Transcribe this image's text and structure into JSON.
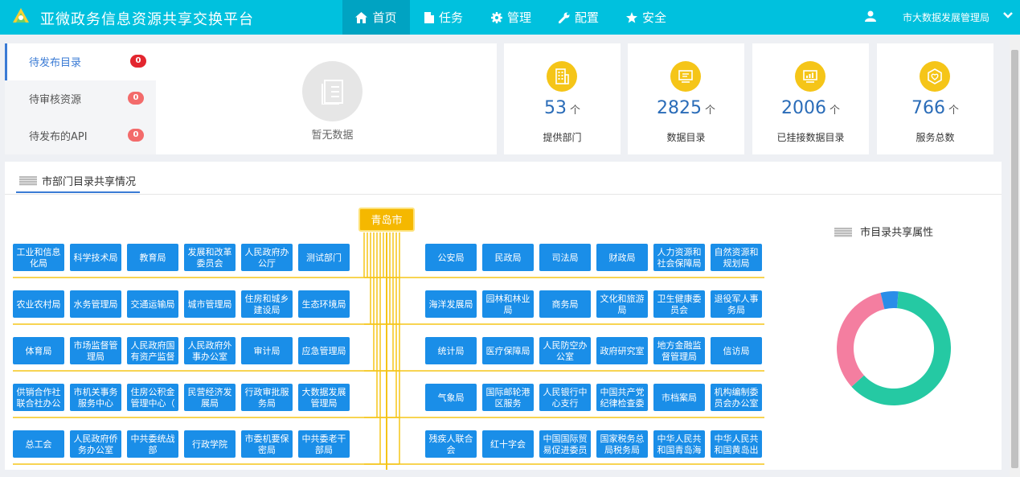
{
  "header": {
    "title": "亚微政务信息资源共享交换平台",
    "nav": [
      {
        "label": "首页",
        "icon": "home-icon",
        "active": true
      },
      {
        "label": "任务",
        "icon": "document-icon",
        "active": false
      },
      {
        "label": "管理",
        "icon": "gear-icon",
        "active": false
      },
      {
        "label": "配置",
        "icon": "wrench-icon",
        "active": false
      },
      {
        "label": "安全",
        "icon": "star-icon",
        "active": false
      }
    ],
    "user": "市大数据发展管理局"
  },
  "pending_tabs": [
    {
      "label": "待发布目录",
      "count": "0",
      "active": true,
      "badge_color": "#e3262f"
    },
    {
      "label": "待审核资源",
      "count": "0",
      "active": false,
      "badge_color": "#f36b6b"
    },
    {
      "label": "待发布的API",
      "count": "0",
      "active": false,
      "badge_color": "#f36b6b"
    }
  ],
  "empty_text": "暂无数据",
  "stats": [
    {
      "value": "53",
      "unit": "个",
      "label": "提供部门",
      "icon": "building-icon"
    },
    {
      "value": "2825",
      "unit": "个",
      "label": "数据目录",
      "icon": "monitor-icon"
    },
    {
      "value": "2006",
      "unit": "个",
      "label": "已挂接数据目录",
      "icon": "chart-screen-icon"
    },
    {
      "value": "766",
      "unit": "个",
      "label": "服务总数",
      "icon": "shield-heart-icon"
    }
  ],
  "share_tab": "市部门目录共享情况",
  "attr_title": "市目录共享属性",
  "colors": {
    "header": "#00c1de",
    "node": "#1a8ee8",
    "root": "#f5b800",
    "line": "#f5c518",
    "stat_icon": "#f5c518"
  },
  "org_tree": {
    "root": "青岛市",
    "left_rows": [
      [
        "工业和信息化局",
        "科学技术局",
        "教育局",
        "发展和改革委员会",
        "人民政府办公厅",
        "测试部门"
      ],
      [
        "农业农村局",
        "水务管理局",
        "交通运输局",
        "城市管理局",
        "住房和城乡建设局",
        "生态环境局"
      ],
      [
        "体育局",
        "市场监督管理局",
        "人民政府国有资产监督",
        "人民政府外事办公室",
        "审计局",
        "应急管理局"
      ],
      [
        "供销合作社联合社办公",
        "市机关事务服务中心",
        "住房公积金管理中心（",
        "民营经济发展局",
        "行政审批服务局",
        "大数据发展管理局"
      ],
      [
        "总工会",
        "人民政府侨务办公室",
        "中共委统战部",
        "行政学院",
        "市委机要保密局",
        "中共委老干部局"
      ]
    ],
    "right_rows": [
      [
        "公安局",
        "民政局",
        "司法局",
        "财政局",
        "人力资源和社会保障局",
        "自然资源和规划局"
      ],
      [
        "海洋发展局",
        "园林和林业局",
        "商务局",
        "文化和旅游局",
        "卫生健康委员会",
        "退役军人事务局"
      ],
      [
        "统计局",
        "医疗保障局",
        "人民防空办公室",
        "政府研究室",
        "地方金融监督管理局",
        "信访局"
      ],
      [
        "气象局",
        "国际邮轮港区服务",
        "人民银行中心支行",
        "中国共产党纪律检查委",
        "市档案局",
        "机构编制委员会办公室"
      ],
      [
        "残疾人联合会",
        "红十字会",
        "中国国际贸易促进委员",
        "国家税务总局税务局",
        "中华人民共和国青岛海",
        "中华人民共和国黄岛出"
      ]
    ]
  },
  "chart_data": {
    "type": "pie",
    "values": [
      62,
      33,
      5
    ],
    "colors": [
      "#25c9a3",
      "#f47ea0",
      "#2a8de8"
    ]
  }
}
